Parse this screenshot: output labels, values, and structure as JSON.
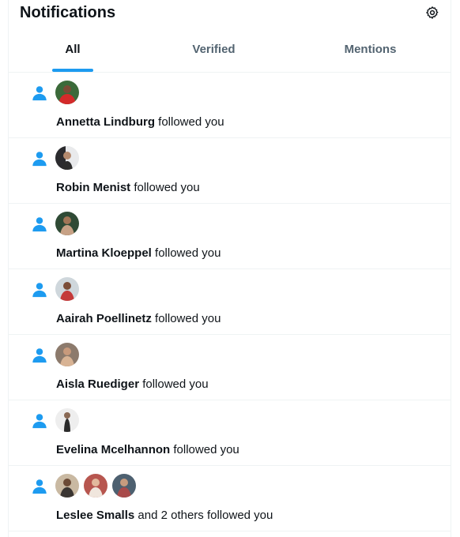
{
  "header": {
    "title": "Notifications",
    "settings_icon": "gear-icon"
  },
  "tabs": [
    {
      "label": "All",
      "active": true
    },
    {
      "label": "Verified",
      "active": false
    },
    {
      "label": "Mentions",
      "active": false
    }
  ],
  "colors": {
    "accent": "#1d9bf0",
    "text": "#0f1419",
    "muted": "#536471",
    "divider": "#eff3f4"
  },
  "notifications": [
    {
      "icon": "person-icon",
      "name": "Annetta Lindburg",
      "action": " followed you",
      "avatars": 1
    },
    {
      "icon": "person-icon",
      "name": "Robin Menist",
      "action": " followed you",
      "avatars": 1
    },
    {
      "icon": "person-icon",
      "name": "Martina Kloeppel",
      "action": " followed you",
      "avatars": 1
    },
    {
      "icon": "person-icon",
      "name": "Aairah Poellinetz",
      "action": " followed you",
      "avatars": 1
    },
    {
      "icon": "person-icon",
      "name": "Aisla Ruediger",
      "action": " followed you",
      "avatars": 1
    },
    {
      "icon": "person-icon",
      "name": "Evelina Mcelhannon",
      "action": " followed you",
      "avatars": 1
    },
    {
      "icon": "person-icon",
      "name": "Leslee Smalls",
      "action": " and 2 others followed you",
      "avatars": 3
    }
  ]
}
